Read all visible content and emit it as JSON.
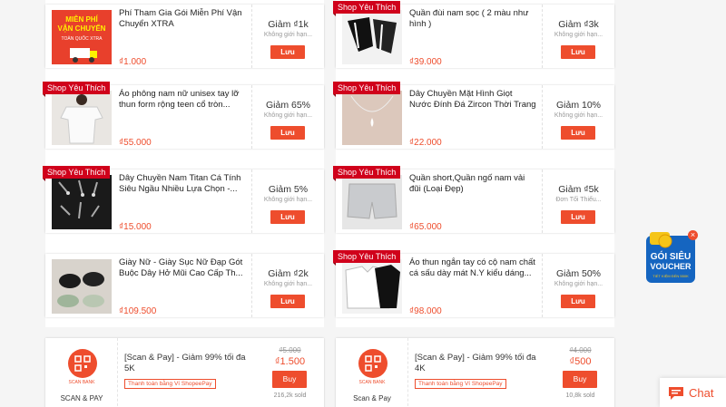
{
  "vouchers": [
    {
      "tag": "",
      "title": "Phí Tham Gia Gói Miễn Phí Vận Chuyển XTRA",
      "price": "₫1.000",
      "discount": "Giảm ₫1k",
      "limit": "Không giới hạn...",
      "save": "Lưu",
      "thumb_text": [
        "MIỄN PHÍ",
        "VẬN CHUYỂN",
        "TOÀN QUỐC XTRA"
      ]
    },
    {
      "tag": "Shop Yêu Thích",
      "title": "Quần đùi nam sọc ( 2 màu như hình )",
      "price": "₫39.000",
      "discount": "Giảm ₫3k",
      "limit": "Không giới hạn...",
      "save": "Lưu"
    },
    {
      "tag": "Shop Yêu Thích",
      "title": "Áo phông nam nữ unisex tay lỡ thun form rộng teen cổ tròn...",
      "price": "₫55.000",
      "discount": "Giảm 65%",
      "limit": "Không giới hạn...",
      "save": "Lưu"
    },
    {
      "tag": "Shop Yêu Thích",
      "title": "Dây Chuyền Mặt Hình Giọt Nước Đính Đá Zircon Thời Trang Cho...",
      "price": "₫22.000",
      "discount": "Giảm 10%",
      "limit": "Không giới hạn...",
      "save": "Lưu"
    },
    {
      "tag": "Shop Yêu Thích",
      "title": "Dây Chuyền Nam Titan Cá Tính Siêu Ngầu Nhiều Lựa Chọn -...",
      "price": "₫15.000",
      "discount": "Giảm 5%",
      "limit": "Không giới hạn...",
      "save": "Lưu"
    },
    {
      "tag": "Shop Yêu Thích",
      "title": "Quần short,Quần ngố nam vải đũi (Loại Đẹp)",
      "price": "₫65.000",
      "discount": "Giảm ₫5k",
      "limit": "Đơn Tối Thiểu...",
      "save": "Lưu"
    },
    {
      "tag": "",
      "title": "Giày Nữ - Giày Sục Nữ Đạp Gót Buộc Dây Hở Mũi Cao Cấp Th...",
      "price": "₫109.500",
      "discount": "Giảm ₫2k",
      "limit": "Không giới hạn...",
      "save": "Lưu"
    },
    {
      "tag": "Shop Yêu Thích",
      "title": "Áo thun ngắn tay có cộ nam chất cá sấu dày mát N.Y kiểu dáng...",
      "price": "₫98.000",
      "discount": "Giảm 50%",
      "limit": "Không giới hạn...",
      "save": "Lưu"
    }
  ],
  "scanpay": [
    {
      "qr_label": "SCAN BANK",
      "label": "SCAN & PAY",
      "title": "[Scan & Pay] - Giảm 99% tối đa 5K",
      "pay_tag": "Thanh toán bằng Ví ShopeePay",
      "old_price": "₫5.000",
      "new_price": "₫1.500",
      "buy": "Buy",
      "sold": "216,2k sold"
    },
    {
      "qr_label": "SCAN BANK",
      "label": "Scan & Pay",
      "title": "[Scan & Pay] - Giảm 99% tối đa 4K",
      "pay_tag": "Thanh toán bằng Ví ShopeePay",
      "old_price": "₫4.000",
      "new_price": "₫500",
      "buy": "Buy",
      "sold": "10,8k sold"
    }
  ],
  "floating_voucher": {
    "line1": "GÓI SIÊU",
    "line2": "VOUCHER",
    "line3": "TIẾT KIỆM ĐẾN 550K",
    "close": "×"
  },
  "chat": {
    "label": "Chat"
  },
  "colors": {
    "accent": "#ee4d2d",
    "tag": "#d0011b"
  }
}
